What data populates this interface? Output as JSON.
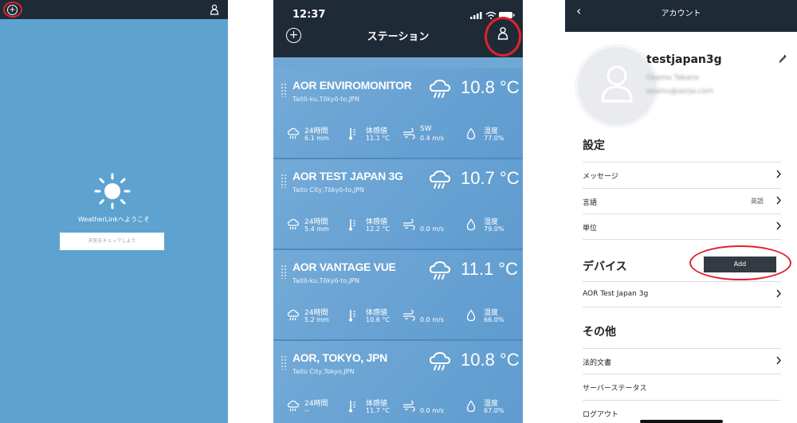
{
  "panel1": {
    "welcome_text": "WeatherLinkへようこそ",
    "check_button_label": "天気をチェックしよう",
    "plus_glyph": "+",
    "highlight_color": "#e0222b"
  },
  "panel2": {
    "status_time": "12:37",
    "title": "ステーション",
    "plus_glyph": "+",
    "stations": [
      {
        "name": "AOR ENVIROMONITOR",
        "location": "Taitō-ku,Tōkyō-to,JPN",
        "temp": "10.8 °C",
        "rain_label": "24時間",
        "rain_value": "6.1 mm",
        "feels_label": "体感値",
        "feels_value": "11.1 °C",
        "wind_dir": "SW",
        "wind_value": "0.4 m/s",
        "humidity_label": "湿度",
        "humidity_value": "77.0%"
      },
      {
        "name": "AOR TEST JAPAN 3G",
        "location": "Taito City,Tōkyō-to,JPN",
        "temp": "10.7 °C",
        "rain_label": "24時間",
        "rain_value": "5.4 mm",
        "feels_label": "体感値",
        "feels_value": "12.2 °C",
        "wind_dir": "",
        "wind_value": "0.0 m/s",
        "humidity_label": "湿度",
        "humidity_value": "79.0%"
      },
      {
        "name": "AOR VANTAGE VUE",
        "location": "Taitō-ku,Tōkyō-to,JPN",
        "temp": "11.1 °C",
        "rain_label": "24時間",
        "rain_value": "5.2 mm",
        "feels_label": "体感値",
        "feels_value": "10.6 °C",
        "wind_dir": "",
        "wind_value": "0.0 m/s",
        "humidity_label": "湿度",
        "humidity_value": "66.0%"
      },
      {
        "name": "AOR, TOKYO, JPN",
        "location": "Taito City,Tokyo,JPN",
        "temp": "10.8 °C",
        "rain_label": "24時間",
        "rain_value": "--",
        "feels_label": "体感値",
        "feels_value": "11.7 °C",
        "wind_dir": "",
        "wind_value": "0.0 m/s",
        "humidity_label": "湿度",
        "humidity_value": "67.0%"
      }
    ]
  },
  "panel3": {
    "title": "アカウント",
    "back_glyph": "‹",
    "username": "testjapan3g",
    "blurred_name": "Osamu Takano",
    "blurred_email": "osamu@aorja.com",
    "settings_heading": "設定",
    "settings_rows": [
      {
        "label": "メッセージ",
        "value": ""
      },
      {
        "label": "言語",
        "value": "英語"
      },
      {
        "label": "単位",
        "value": ""
      }
    ],
    "devices_heading": "デバイス",
    "add_label": "Add",
    "device_rows": [
      {
        "label": "AOR Test Japan 3g"
      }
    ],
    "other_heading": "その他",
    "other_rows": [
      {
        "label": "法的文書",
        "chevron": true
      },
      {
        "label": "サーバーステータス",
        "chevron": false
      },
      {
        "label": "ログアウト",
        "chevron": false
      }
    ]
  }
}
